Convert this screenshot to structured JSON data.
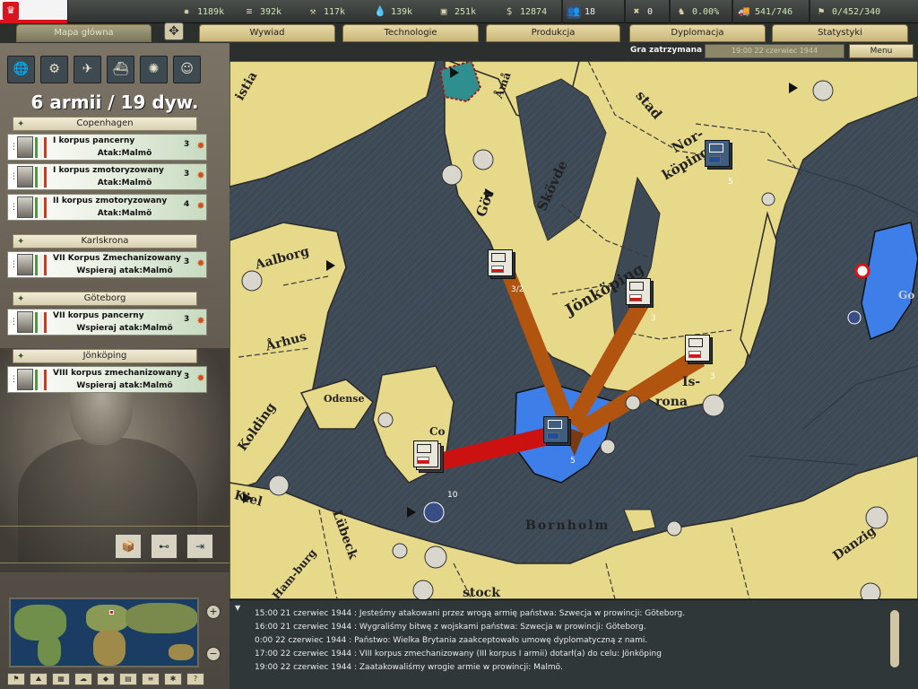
{
  "top": {
    "resources": [
      {
        "icon": "energy-icon",
        "value": "1189k"
      },
      {
        "icon": "metal-icon",
        "value": "392k"
      },
      {
        "icon": "rare-materials-icon",
        "value": "117k"
      },
      {
        "icon": "oil-icon",
        "value": "139k"
      },
      {
        "icon": "supplies-icon",
        "value": "251k"
      },
      {
        "icon": "money-icon",
        "value": "12874"
      },
      {
        "icon": "manpower-icon",
        "value": "18"
      },
      {
        "icon": "diplomacy-icon",
        "value": "0"
      },
      {
        "icon": "dissent-icon",
        "value": "0.00%"
      },
      {
        "icon": "transport-icon",
        "value": "541/746"
      },
      {
        "icon": "divisions-icon",
        "value": "0/452/340"
      }
    ]
  },
  "tabs": [
    "Mapa główna",
    "Wywiad",
    "Technologie",
    "Produkcja",
    "Dyplomacja",
    "Statystyki"
  ],
  "status": {
    "paused": "Gra zatrzymana",
    "date": "19:00 22 czerwiec 1944",
    "menu": "Menu"
  },
  "panel": {
    "title": "6 armii / 19 dyw.",
    "groups": [
      {
        "name": "Copenhagen",
        "armies": [
          {
            "name": "I korpus pancerny",
            "order": "Atak:Malmö",
            "count": "3"
          },
          {
            "name": "I korpus zmotoryzowany",
            "order": "Atak:Malmö",
            "count": "3"
          },
          {
            "name": "II korpus zmotoryzowany",
            "order": "Atak:Malmö",
            "count": "4"
          }
        ]
      },
      {
        "name": "Karlskrona",
        "armies": [
          {
            "name": "VII Korpus Zmechanizowany",
            "order": "Wspieraj atak:Malmö",
            "count": "3"
          }
        ]
      },
      {
        "name": "Göteborg",
        "armies": [
          {
            "name": "VII korpus pancerny",
            "order": "Wspieraj atak:Malmö",
            "count": "3"
          }
        ]
      },
      {
        "name": "Jönköping",
        "armies": [
          {
            "name": "VIII korpus zmechanizowany",
            "order": "Wspieraj atak:Malmö",
            "count": "3"
          }
        ]
      }
    ]
  },
  "map": {
    "labels": [
      {
        "t": "Åmå"
      },
      {
        "t": "stad"
      },
      {
        "t": "Skövde"
      },
      {
        "t": "Göt"
      },
      {
        "t": "Nor-"
      },
      {
        "t": "köping"
      },
      {
        "t": "Jönköping"
      },
      {
        "t": "Aalborg"
      },
      {
        "t": "Århus"
      },
      {
        "t": "Odense"
      },
      {
        "t": "Kolding"
      },
      {
        "t": "Kiel"
      },
      {
        "t": "Lübeck"
      },
      {
        "t": "Bornholm"
      },
      {
        "t": "Danzig"
      },
      {
        "t": "Ham-burg"
      },
      {
        "t": "rona"
      },
      {
        "t": "Is-"
      },
      {
        "t": "stock"
      },
      {
        "t": "Co"
      },
      {
        "t": "istia"
      },
      {
        "t": "Go"
      }
    ],
    "units": [
      {
        "count": "3/2",
        "kind": "poland"
      },
      {
        "count": "3",
        "kind": "poland"
      },
      {
        "count": "3",
        "kind": "poland"
      },
      {
        "count": "5",
        "kind": "sweden"
      },
      {
        "count": "5",
        "kind": "sweden"
      },
      {
        "count": "10",
        "kind": "poland"
      }
    ]
  },
  "log": [
    "15:00 21 czerwiec 1944 : Jesteśmy atakowani przez wrogą armię państwa: Szwecja w prowincji: Göteborg.",
    "16:00 21 czerwiec 1944 : Wygraliśmy bitwę z wojskami państwa: Szwecja w prowincji: Göteborg.",
    "0:00 22 czerwiec 1944 : Państwo: Wielka Brytania zaakceptowało umowę dyplomatyczną z nami.",
    "17:00 22 czerwiec 1944 : VIII korpus zmechanizowany (III korpus I armii) dotarł(a) do celu: Jönköping",
    "19:00 22 czerwiec 1944 : Zaatakowaliśmy wrogie armie w prowincji: Malmö."
  ],
  "colors": {
    "land": "#e7d98a",
    "sea": "#3d4a56",
    "lake": "#3d7ee8",
    "enemy_arrow": "#b0540f",
    "friendly_arrow": "#cc1111"
  }
}
